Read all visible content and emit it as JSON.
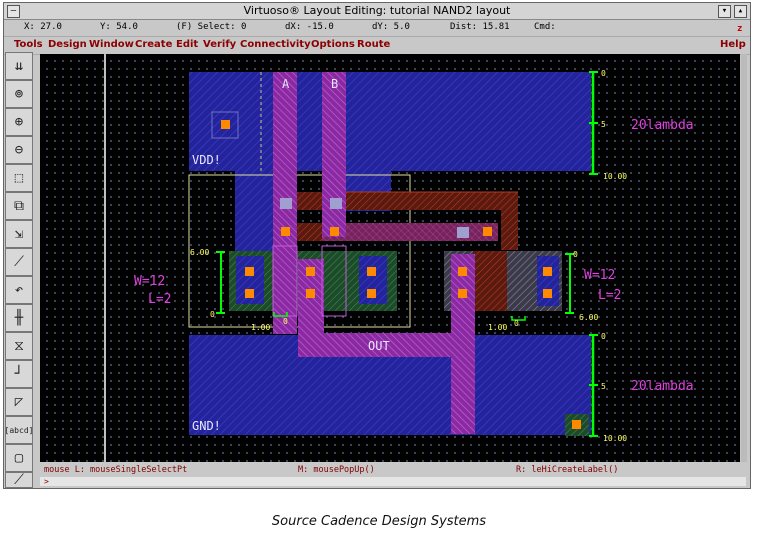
{
  "window": {
    "title": "Virtuoso® Layout Editing: tutorial NAND2 layout",
    "corner_letter": "z"
  },
  "status": {
    "x": "X: 27.0",
    "y": "Y: 54.0",
    "select": "(F) Select: 0",
    "dx": "dX: -15.0",
    "dy": "dY: 5.0",
    "dist": "Dist: 15.81",
    "cmd": "Cmd:"
  },
  "menu": {
    "items": [
      "Tools",
      "Design",
      "Window",
      "Create",
      "Edit",
      "Verify",
      "Connectivity",
      "Options",
      "Route"
    ],
    "help": "Help"
  },
  "toolbar": {
    "icons": [
      "save-icon",
      "zoom-fit-icon",
      "zoom-in-icon",
      "zoom-out-icon",
      "stretch-icon",
      "copy-icon",
      "move-icon",
      "path-icon",
      "undo-icon",
      "align-icon",
      "reshape-icon",
      "step-icon",
      "chop-icon",
      "label-icon",
      "select-icon",
      "ruler-icon"
    ],
    "label_tool": "[abcd]"
  },
  "layout": {
    "pins": {
      "a": "A",
      "b": "B",
      "out": "OUT"
    },
    "rails": {
      "vdd": "VDD!",
      "gnd": "GND!"
    },
    "pmos": {
      "width": "W=12",
      "length": "L=2",
      "dim_top": "6.00",
      "dim_bottom": "0",
      "dim_length": "1.00",
      "dim_zero": "0"
    },
    "nmos": {
      "width": "W=12",
      "length": "L=2",
      "dim_top": "0",
      "dim_bottom": "6.00",
      "dim_length": "1.00",
      "dim_zero": "0"
    },
    "ruler_top": {
      "start": "0",
      "mid": "5",
      "end": "10.00",
      "label": "20lambda"
    },
    "ruler_bottom": {
      "start": "0",
      "mid": "5",
      "end": "10.00",
      "label": "20lambda"
    }
  },
  "mouse": {
    "left": "mouse L: mouseSingleSelectPt",
    "middle": "M: mousePopUp()",
    "right": "R: leHiCreateLabel()"
  },
  "prompt": ">",
  "caption": "Source Cadence Design Systems"
}
